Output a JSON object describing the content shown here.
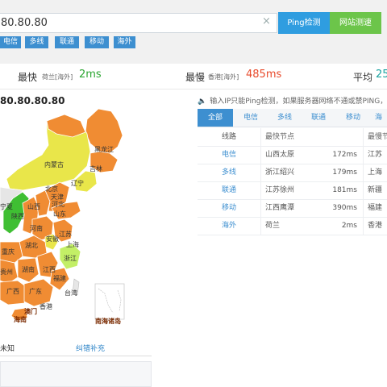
{
  "search": {
    "value": "80.80.80"
  },
  "buttons": {
    "ping": "Ping检测",
    "site": "网站测速",
    "clear": "×"
  },
  "isp_tags": [
    "电信",
    "多线",
    "联通",
    "移动",
    "海外"
  ],
  "stats": {
    "fastest": {
      "label": "最快",
      "location": "荷兰[海外]",
      "value": "2ms"
    },
    "slowest": {
      "label": "最慢",
      "location": "香港[海外]",
      "value": "485ms"
    },
    "average": {
      "label": "平均",
      "value": "25"
    }
  },
  "ip_title": "80.80.80.80",
  "notice": "输入IP只能Ping检测，如果服务器网络不通或禁PING，",
  "tabs": [
    "全部",
    "电信",
    "多线",
    "联通",
    "移动",
    "海"
  ],
  "table": {
    "headers": {
      "line": "线路",
      "fastest": "最快节点",
      "slowest": "最慢节"
    },
    "rows": [
      {
        "line": "电信",
        "fast_node": "山西太原",
        "fast_ms": "172ms",
        "slow_node": "江苏"
      },
      {
        "line": "多线",
        "fast_node": "浙江绍兴",
        "fast_ms": "179ms",
        "slow_node": "上海"
      },
      {
        "line": "联通",
        "fast_node": "江苏徐州",
        "fast_ms": "181ms",
        "slow_node": "新疆"
      },
      {
        "line": "移动",
        "fast_node": "江西鹰潭",
        "fast_ms": "390ms",
        "slow_node": "福建"
      },
      {
        "line": "海外",
        "fast_node": "荷兰",
        "fast_ms": "2ms",
        "slow_node": "香港"
      }
    ]
  },
  "map_labels": {
    "heilongjiang": "黑龙江",
    "jilin": "吉林",
    "liaoning": "辽宁",
    "neimenggu": "内蒙古",
    "beijing": "北京",
    "tianjin": "天津",
    "hebei": "河北",
    "shanxi": "山西",
    "shandong": "山东",
    "ningxia": "宁夏",
    "shaanxi": "陕西",
    "henan": "河南",
    "jiangsu": "江苏",
    "anhui": "安徽",
    "shanghai": "上海",
    "hubei": "湖北",
    "chongqing": "重庆",
    "zhejiang": "浙江",
    "guizhou": "贵州",
    "hunan": "湖南",
    "jiangxi": "江西",
    "fujian": "福建",
    "guangxi": "广西",
    "guangdong": "广东",
    "taiwan": "台湾",
    "xianggang": "香港",
    "aomen": "澳门",
    "hainan": "海南",
    "nanhai": "南海诸岛"
  },
  "legend": {
    "unknown": "未知",
    "error_link": "纠错补充"
  },
  "colors": {
    "accent": "#3d8fd0",
    "ping_button": "#2f9de0",
    "site_button": "#6cc54a",
    "fast_green": "#2aa530",
    "slow_red": "#e84a2b",
    "avg_teal": "#1aa2a0",
    "map_orange": "#f08c33",
    "map_yellow": "#e9e64a",
    "map_green": "#3fbf33",
    "map_gray": "#e6e6e6"
  }
}
